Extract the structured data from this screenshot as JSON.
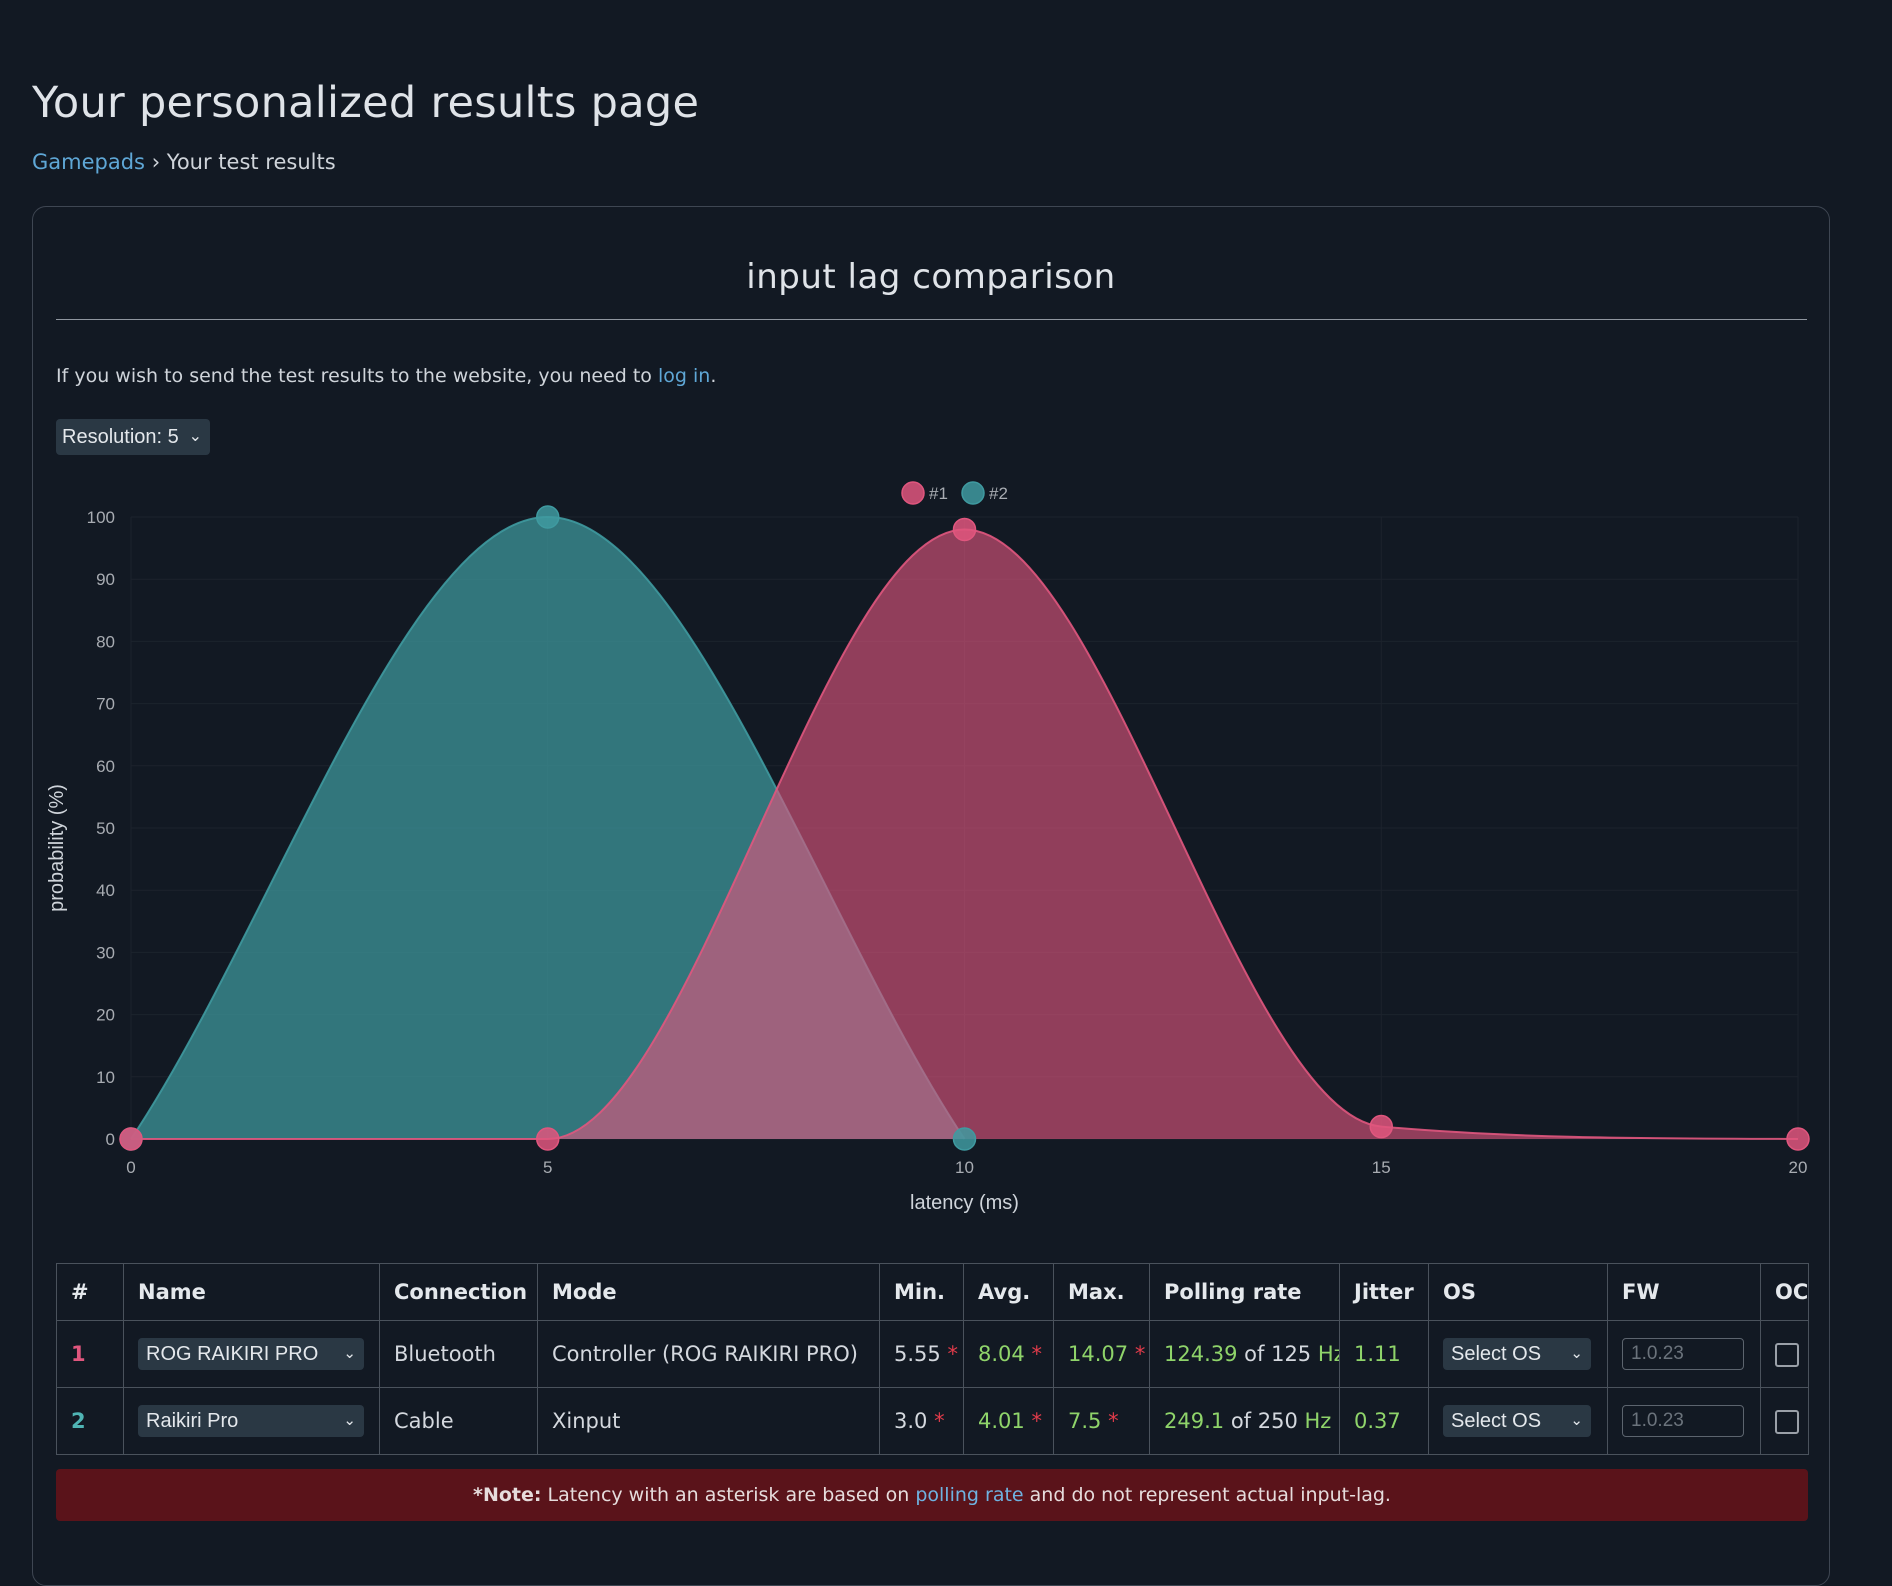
{
  "page": {
    "title": "Your personalized results page"
  },
  "breadcrumb": {
    "parent": "Gamepads",
    "separator": "›",
    "current": "Your test results"
  },
  "card": {
    "title": "input lag comparison",
    "notice_prefix": "If you wish to send the test results to the website, you need to",
    "notice_link": "log in",
    "notice_suffix": "."
  },
  "resolution": {
    "label": "Resolution:",
    "value": "5"
  },
  "chart_data": {
    "type": "area",
    "xlabel": "latency (ms)",
    "ylabel": "probability (%)",
    "xlim": [
      0,
      20
    ],
    "ylim": [
      0,
      100
    ],
    "xticks": [
      0,
      5,
      10,
      15,
      20
    ],
    "yticks": [
      0,
      10,
      20,
      30,
      40,
      50,
      60,
      70,
      80,
      90,
      100
    ],
    "legend_position": "top-center",
    "series": [
      {
        "name": "#1",
        "color": "#e0567e",
        "x": [
          0,
          5,
          10,
          15,
          20
        ],
        "values": [
          0,
          0,
          98,
          2,
          0
        ]
      },
      {
        "name": "#2",
        "color": "#3f9aa0",
        "x": [
          0,
          5,
          10
        ],
        "values": [
          0,
          100,
          0
        ]
      }
    ]
  },
  "table": {
    "headers": [
      "#",
      "Name",
      "Connection",
      "Mode",
      "Min.",
      "Avg.",
      "Max.",
      "Polling rate",
      "Jitter",
      "OS",
      "FW",
      "OC"
    ],
    "rows": [
      {
        "num": "1",
        "name": "ROG RAIKIRI PRO",
        "connection": "Bluetooth",
        "mode": "Controller (ROG RAIKIRI PRO)",
        "min": "5.55",
        "avg": "8.04",
        "max": "14.07",
        "polling_value": "124.39",
        "polling_of": "of 125",
        "polling_unit": "Hz",
        "jitter": "1.11",
        "os": "Select OS",
        "fw_placeholder": "1.0.23"
      },
      {
        "num": "2",
        "name": "Raikiri Pro",
        "connection": "Cable",
        "mode": "Xinput",
        "min": "3.0",
        "avg": "4.01",
        "max": "7.5",
        "polling_value": "249.1",
        "polling_of": "of 250",
        "polling_unit": "Hz",
        "jitter": "0.37",
        "os": "Select OS",
        "fw_placeholder": "1.0.23"
      }
    ],
    "asterisk": "*"
  },
  "note": {
    "bold": "*Note:",
    "text_before": "Latency with an asterisk are based on",
    "link": "polling rate",
    "text_after": "and do not represent actual input-lag."
  }
}
